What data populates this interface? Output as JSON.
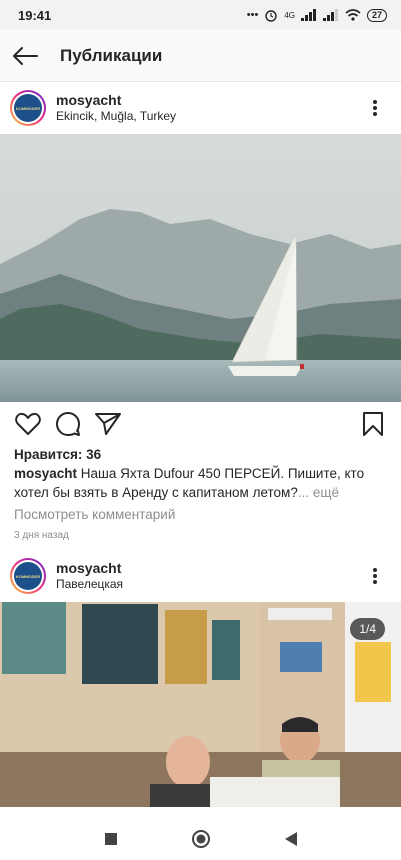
{
  "status": {
    "time": "19:41",
    "network": "4G",
    "battery": "27"
  },
  "topbar": {
    "title": "Публикации"
  },
  "posts": [
    {
      "user": "mosyacht",
      "location": "Ekincik, Muğla, Turkey",
      "likes": "Нравится: 36",
      "caption_user": "mosyacht",
      "caption_text": "Наша Яхта Dufour 450 ПЕРСЕЙ.  Пишите, кто хотел бы взять в Аренду с капитаном летом?",
      "caption_more": "... ещё",
      "comments_link": "Посмотреть комментарий",
      "date": "3 дня назад"
    },
    {
      "user": "mosyacht",
      "location": "Павелецкая",
      "counter": "1/4"
    }
  ],
  "avatar_text": "KOMMODER",
  "icons": {
    "back": "arrow-left-icon",
    "more": "more-vertical-icon",
    "like": "heart-icon",
    "comment": "comment-icon",
    "share": "paper-plane-icon",
    "save": "bookmark-icon"
  },
  "colors": {
    "link_gray": "#8e8e8e",
    "text": "#262626",
    "avatar_bg": "#1d4f8a"
  }
}
